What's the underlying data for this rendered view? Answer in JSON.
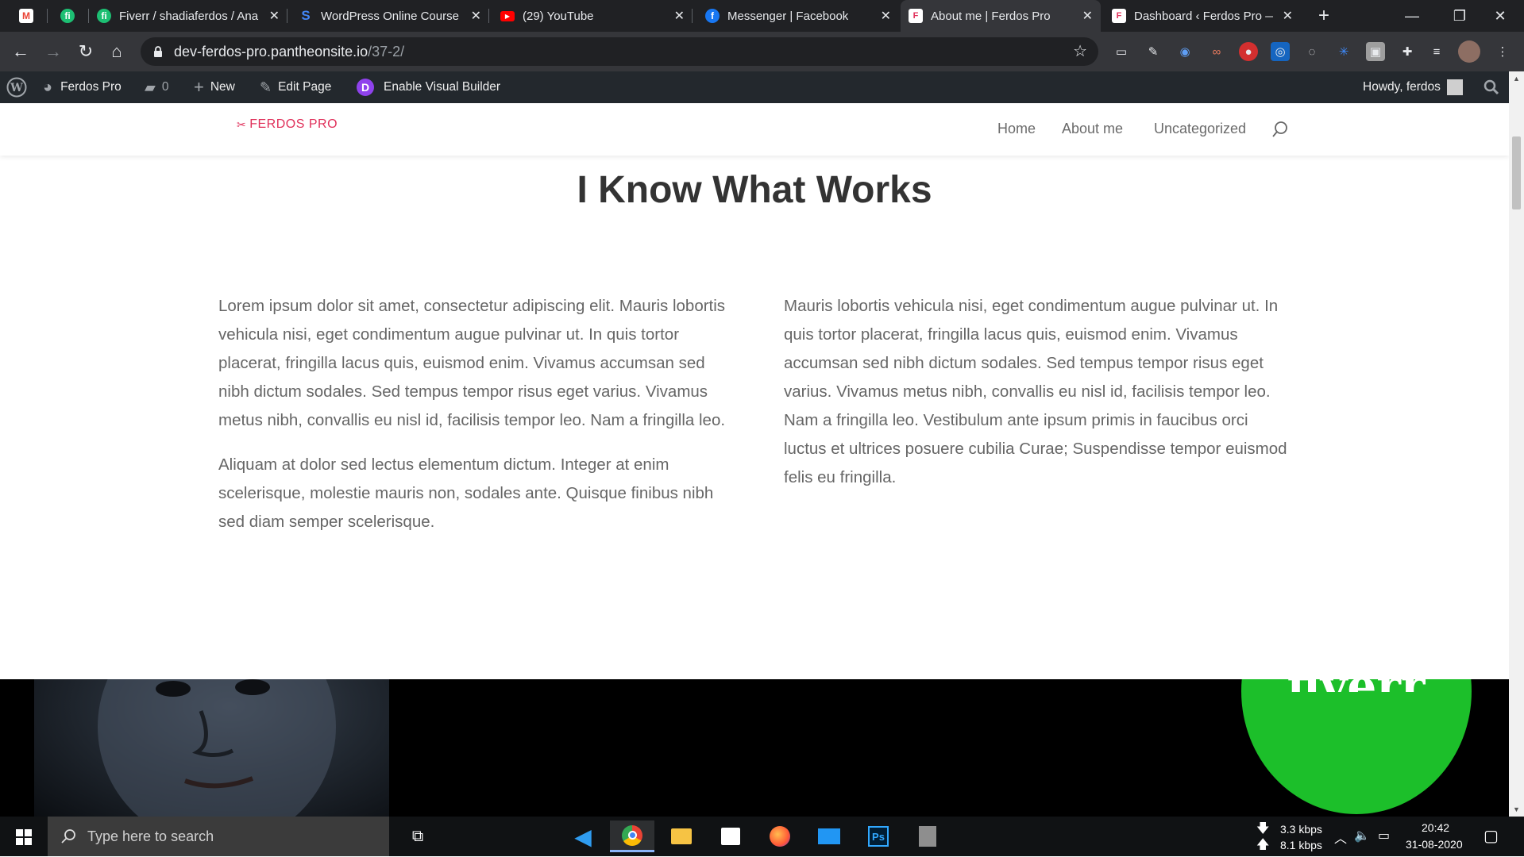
{
  "browser": {
    "tabs": [
      {
        "title": "",
        "icon": "gmail-icon",
        "color": "#ea4335"
      },
      {
        "title": "",
        "icon": "fiverr-icon",
        "color": "#1dbf73"
      },
      {
        "title": "Fiverr / shadiaferdos / Ana",
        "icon": "fiverr-icon",
        "color": "#1dbf73"
      },
      {
        "title": "WordPress Online Course",
        "icon": "course-icon",
        "color": "#4285f4"
      },
      {
        "title": "(29) YouTube",
        "icon": "youtube-icon",
        "color": "#ff0000"
      },
      {
        "title": "Messenger | Facebook",
        "icon": "facebook-icon",
        "color": "#1877f2"
      },
      {
        "title": "About me | Ferdos Pro",
        "icon": "site-icon",
        "color": "#ffffff"
      },
      {
        "title": "Dashboard ‹ Ferdos Pro —",
        "icon": "site-icon",
        "color": "#ffffff"
      }
    ],
    "url_host": "dev-ferdos-pro.pantheonsite.io",
    "url_path": "/37-2/"
  },
  "adminbar": {
    "site_name": "Ferdos Pro",
    "comments_count": "0",
    "new_label": "New",
    "edit_label": "Edit Page",
    "builder_label": "Enable Visual Builder",
    "howdy": "Howdy, ferdos"
  },
  "site": {
    "logo_text": "FERDOS PRO",
    "menu": [
      "Home",
      "About me",
      "Uncategorized"
    ]
  },
  "content": {
    "heading": "I Know What Works",
    "col1_p1": "Lorem ipsum dolor sit amet, consectetur adipiscing elit. Mauris lobortis vehicula nisi, eget condimentum augue pulvinar ut. In quis tortor placerat, fringilla lacus quis, euismod enim. Vivamus accumsan sed nibh dictum sodales. Sed tempus tempor risus eget varius. Vivamus metus nibh, convallis eu nisl id, facilisis tempor leo. Nam a fringilla leo.",
    "col1_p2": "Aliquam at dolor sed lectus elementum dictum. Integer at enim scelerisque, molestie mauris non, sodales ante. Quisque finibus nibh sed diam semper scelerisque.",
    "col2_p1": "Mauris lobortis vehicula nisi, eget condimentum augue pulvinar ut. In quis tortor placerat, fringilla lacus quis, euismod enim. Vivamus accumsan sed nibh dictum sodales. Sed tempus tempor risus eget varius. Vivamus metus nibh, convallis eu nisl id, facilisis tempor leo. Nam a fringilla leo. Vestibulum ante ipsum primis in faucibus orci luctus et ultrices posuere cubilia Curae; Suspendisse tempor euismod felis eu fringilla."
  },
  "band": {
    "fiverr_text": "fiverr"
  },
  "taskbar": {
    "search_placeholder": "Type here to search",
    "net_down": "3.3 kbps",
    "net_up": "8.1 kbps",
    "time": "20:42",
    "date": "31-08-2020"
  },
  "colors": {
    "accent_pink": "#e0305a",
    "fiverr_green": "#1cbf2a",
    "adminbar_bg": "#23282d"
  }
}
